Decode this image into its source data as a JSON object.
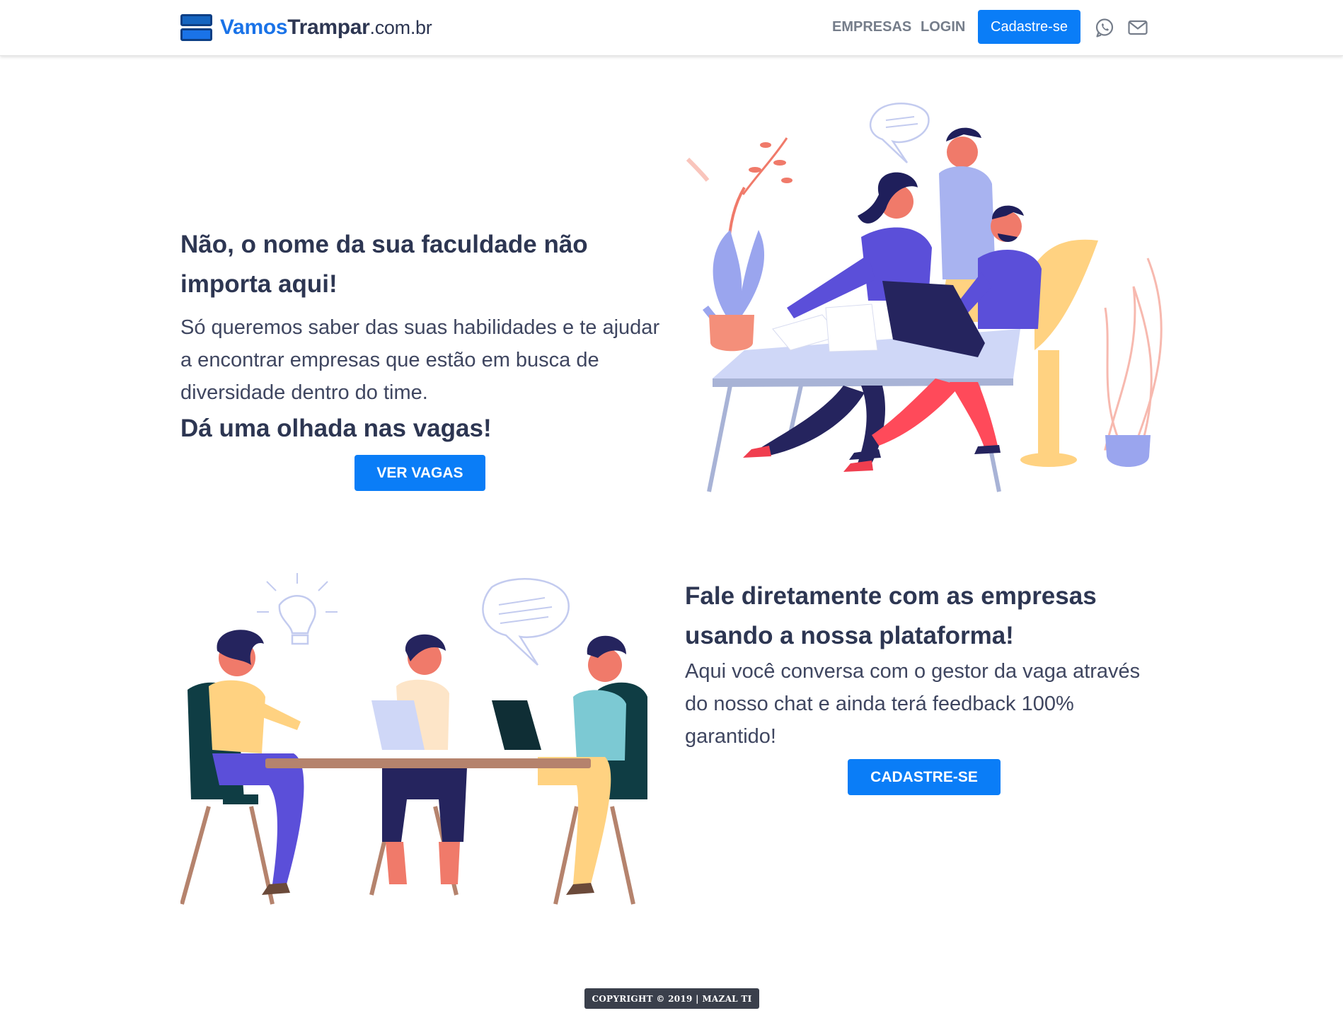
{
  "navbar": {
    "brand": {
      "part1": "Vamos",
      "part2": "Trampar",
      "part3": ".com.br"
    },
    "links": {
      "empresas": "EMPRESAS",
      "login": "LOGIN"
    },
    "cta_label": "Cadastre-se",
    "icons": [
      "whatsapp-icon",
      "mail-icon"
    ]
  },
  "section1": {
    "title": "Não, o nome da sua faculdade não importa aqui!",
    "text": "Só queremos saber das suas habilidades e te ajudar a encontrar empresas que estão em busca de diversidade dentro do time.",
    "cta_title": "Dá uma olhada nas vagas!",
    "button": "VER VAGAS"
  },
  "section2": {
    "title": "Fale diretamente com as empresas usando a nossa plataforma!",
    "text": "Aqui você conversa com o gestor da vaga através do nosso chat e ainda terá feedback 100% garantido!",
    "button": "CADASTRE-SE"
  },
  "footer": {
    "text": "COPYRIGHT © 2019 | MAZAL TI"
  },
  "colors": {
    "primary": "#0a7df7",
    "text": "#2d3652",
    "footer_bg": "#3a3f4b"
  }
}
